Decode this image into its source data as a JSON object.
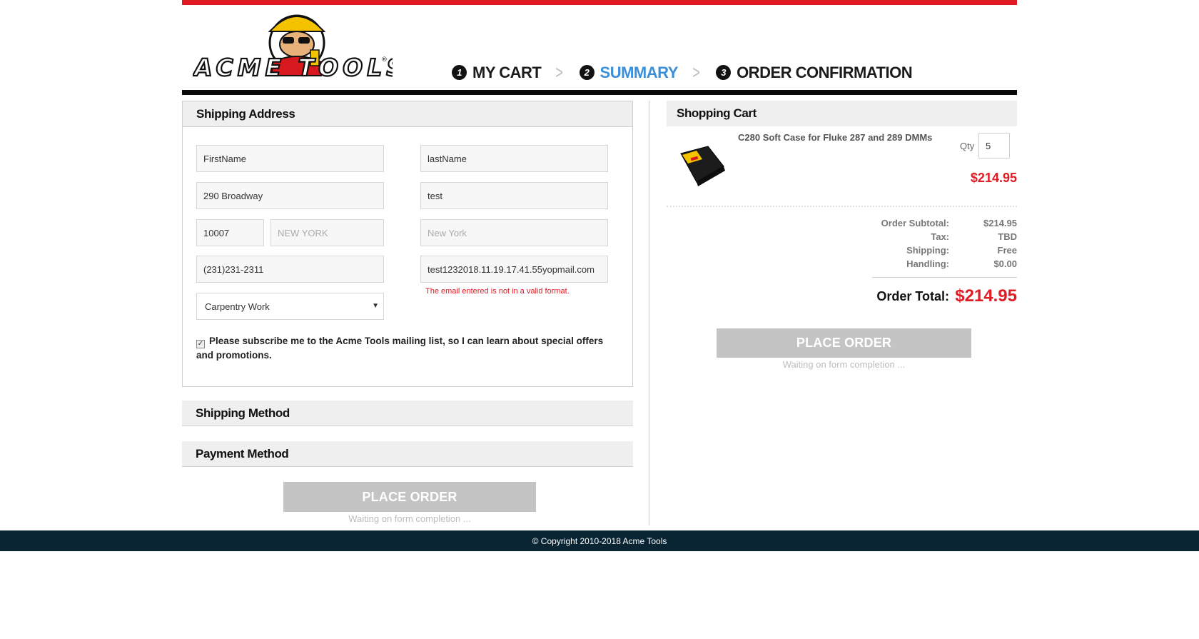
{
  "brand": {
    "name": "ACME TOOLS"
  },
  "steps": [
    {
      "num": "1",
      "label": "MY CART",
      "active": false
    },
    {
      "num": "2",
      "label": "SUMMARY",
      "active": true
    },
    {
      "num": "3",
      "label": "ORDER CONFIRMATION",
      "active": false
    }
  ],
  "shipping_address": {
    "title": "Shipping Address",
    "first_name": "FirstName",
    "last_name": "lastName",
    "address1": "290 Broadway",
    "address2": "test",
    "zip": "10007",
    "city_placeholder": "NEW YORK",
    "state_placeholder": "New York",
    "phone": "(231)231-2311",
    "email": "test1232018.11.19.17.41.55yopmail.com",
    "email_error": "The email entered is not in a valid format.",
    "occupation": "Carpentry Work",
    "subscribe_label": "Please subscribe me to the Acme Tools mailing list, so I can learn about special offers and promotions.",
    "subscribe_checked": true
  },
  "shipping_method": {
    "title": "Shipping Method"
  },
  "payment_method": {
    "title": "Payment Method"
  },
  "place_order": {
    "label": "PLACE ORDER",
    "waiting": "Waiting on form completion ..."
  },
  "cart": {
    "title": "Shopping Cart",
    "items": [
      {
        "name": "C280 Soft Case for Fluke 287 and 289 DMMs",
        "qty_label": "Qty",
        "qty": "5",
        "price": "$214.95"
      }
    ],
    "totals": [
      {
        "label": "Order Subtotal:",
        "value": "$214.95"
      },
      {
        "label": "Tax:",
        "value": "TBD"
      },
      {
        "label": "Shipping:",
        "value": "Free"
      },
      {
        "label": "Handling:",
        "value": "$0.00"
      }
    ],
    "order_total_label": "Order Total:",
    "order_total_value": "$214.95"
  },
  "footer": {
    "copyright": "© Copyright 2010-2018 Acme Tools"
  },
  "colors": {
    "brand_red": "#e01b24",
    "active_step": "#3a8fd8",
    "footer_bg": "#092534",
    "disabled_button": "#c4c4c4"
  },
  "icons": {
    "checkbox": "check-icon",
    "select_caret": "caret-down-icon",
    "step_separator": "chevron-right-icon"
  }
}
